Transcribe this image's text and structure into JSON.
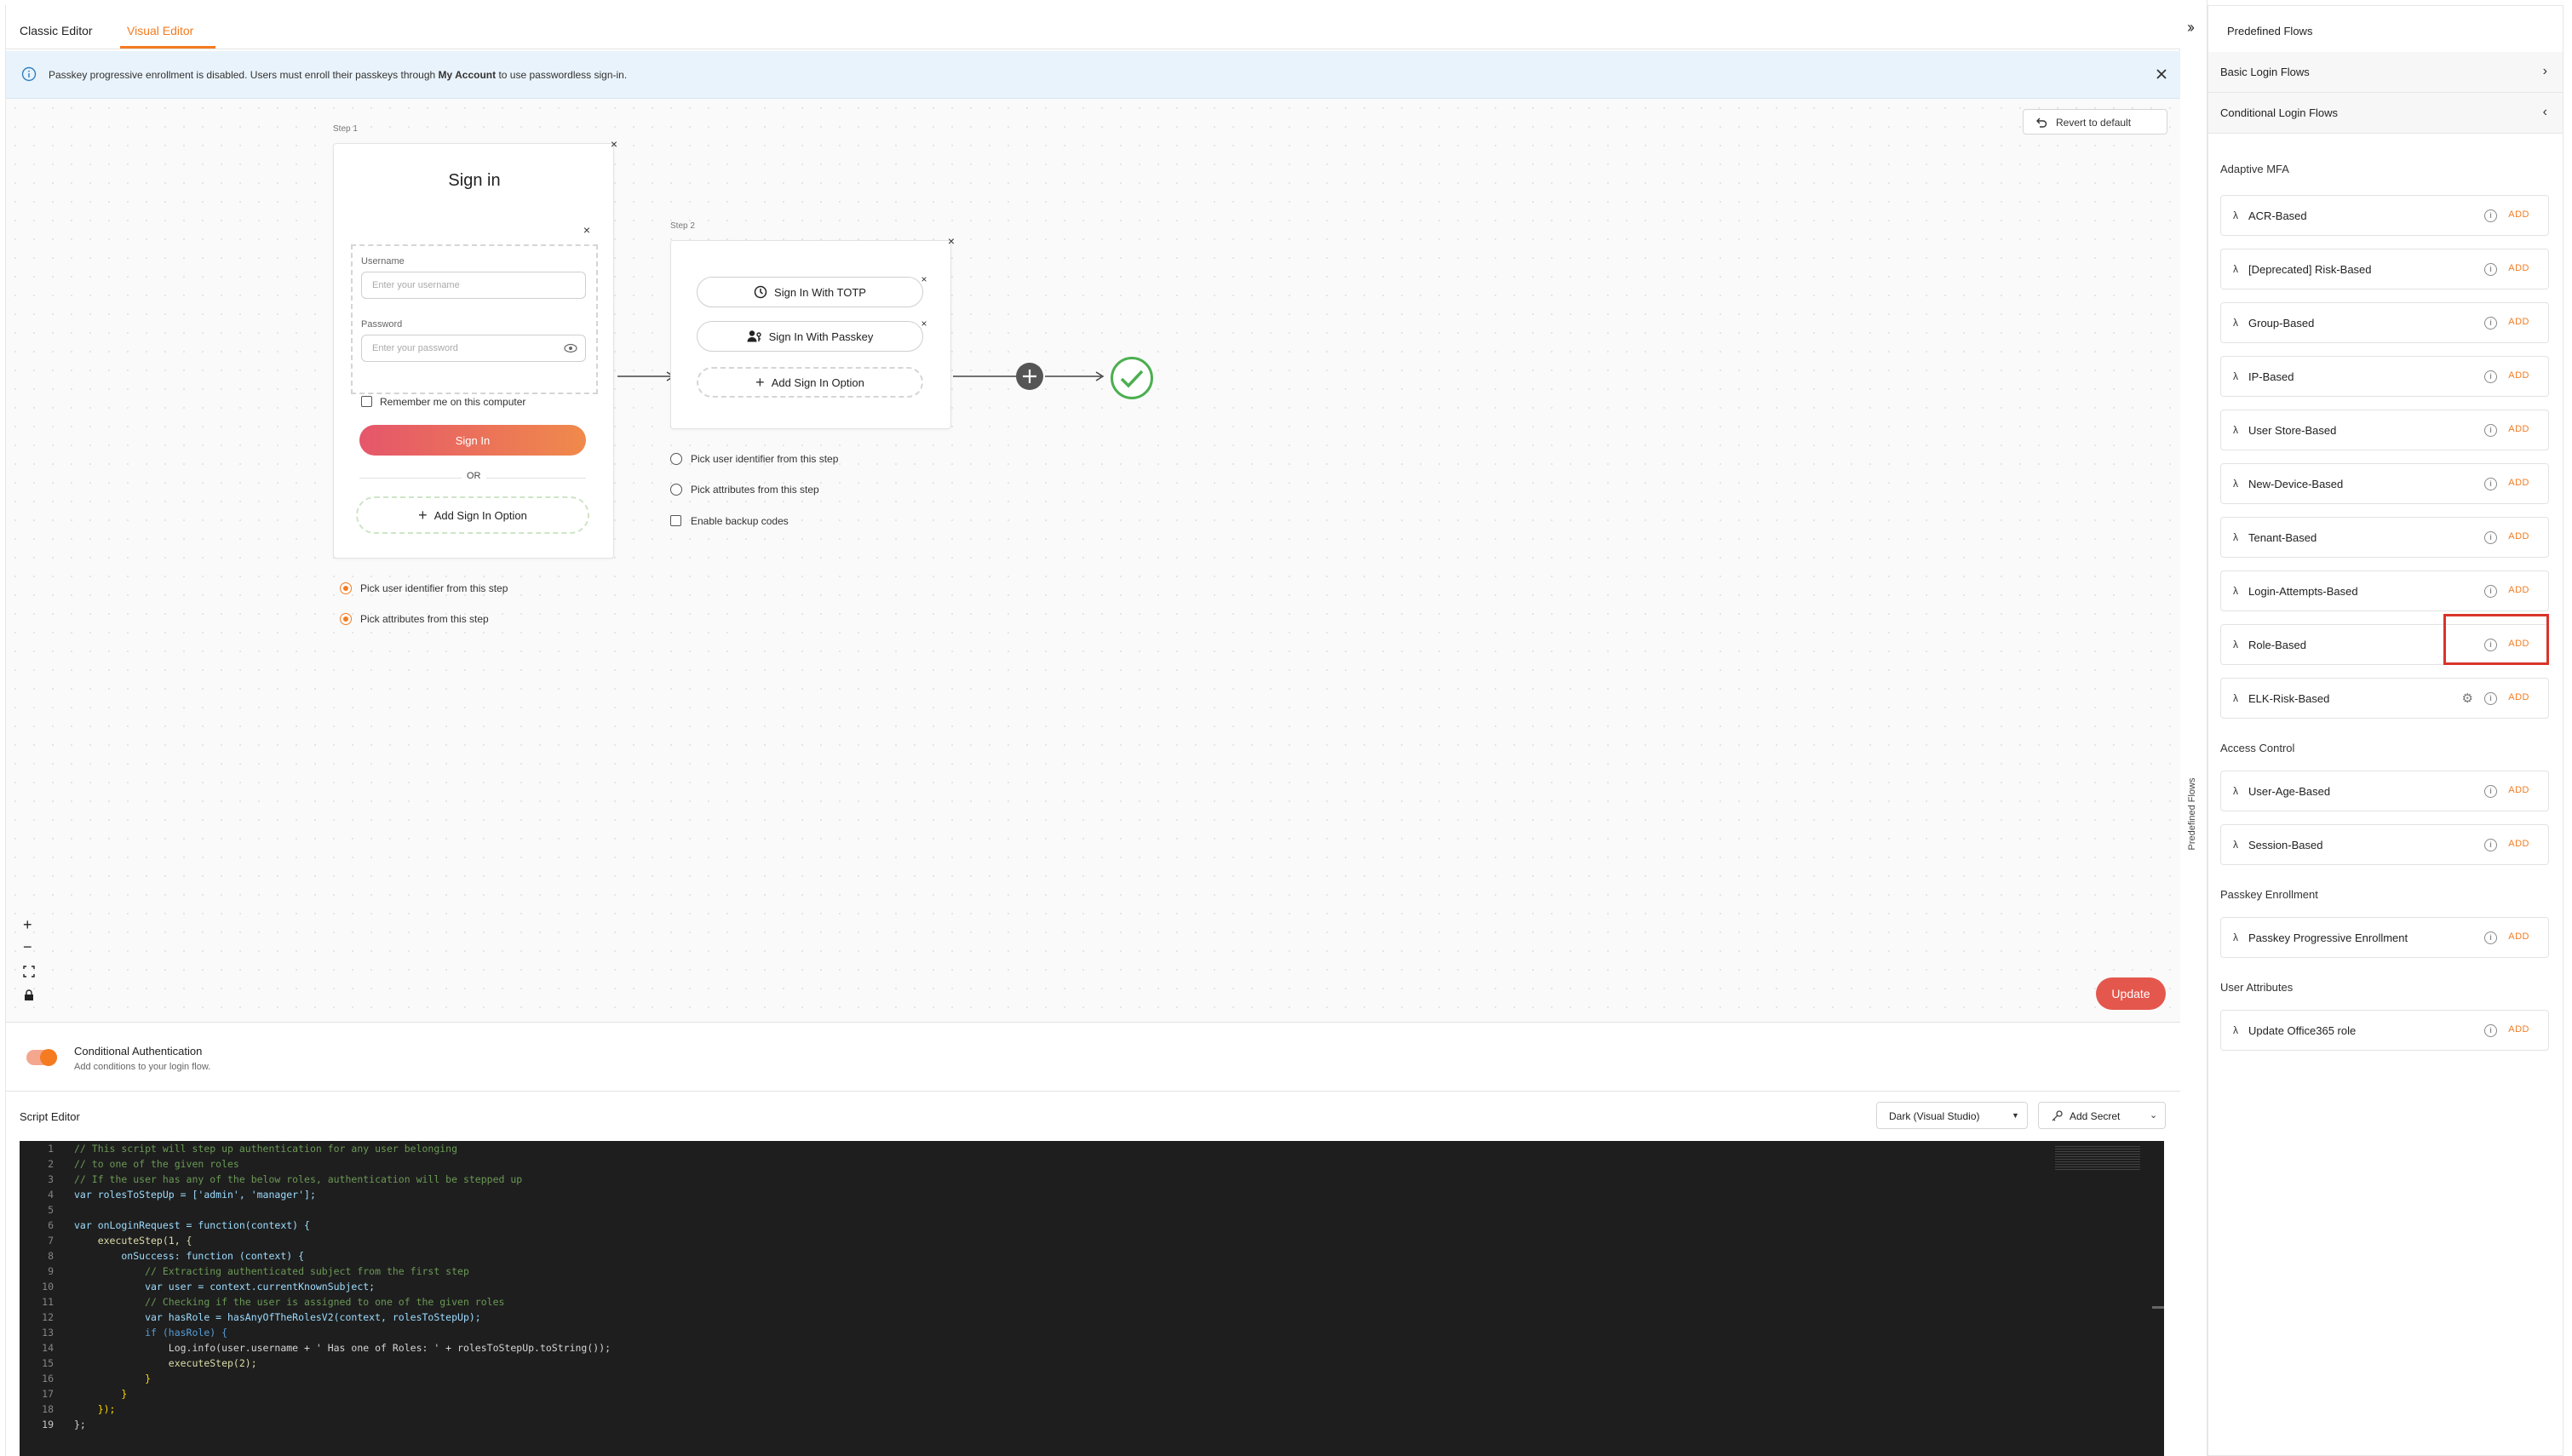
{
  "tabs": {
    "classic": "Classic Editor",
    "visual": "Visual Editor"
  },
  "banner": {
    "text_before": "Passkey progressive enrollment is disabled. Users must enroll their passkeys through ",
    "link": "My Account",
    "text_after": " to use passwordless sign-in."
  },
  "canvas": {
    "revert_label": "Revert to default",
    "update_label": "Update",
    "step1": {
      "label": "Step 1",
      "title": "Sign in",
      "username_label": "Username",
      "username_placeholder": "Enter your username",
      "password_label": "Password",
      "password_placeholder": "Enter your password",
      "remember_label": "Remember me on this computer",
      "signin_button": "Sign In",
      "or_text": "OR",
      "add_option": "Add Sign In Option",
      "opt_identifier": "Pick user identifier from this step",
      "opt_attributes": "Pick attributes from this step"
    },
    "step2": {
      "label": "Step 2",
      "totp": "Sign In With TOTP",
      "passkey": "Sign In With Passkey",
      "add_option": "Add Sign In Option",
      "opt_identifier": "Pick user identifier from this step",
      "opt_attributes": "Pick attributes from this step",
      "opt_backup": "Enable backup codes"
    }
  },
  "conditional": {
    "title": "Conditional Authentication",
    "subtitle": "Add conditions to your login flow.",
    "enabled": true
  },
  "script_editor": {
    "title": "Script Editor",
    "theme": "Dark (Visual Studio)",
    "add_secret": "Add Secret",
    "lines": [
      "// This script will step up authentication for any user belonging",
      "// to one of the given roles",
      "// If the user has any of the below roles, authentication will be stepped up",
      "var rolesToStepUp = ['admin', 'manager'];",
      "",
      "var onLoginRequest = function(context) {",
      "    executeStep(1, {",
      "        onSuccess: function (context) {",
      "            // Extracting authenticated subject from the first step",
      "            var user = context.currentKnownSubject;",
      "            // Checking if the user is assigned to one of the given roles",
      "            var hasRole = hasAnyOfTheRolesV2(context, rolesToStepUp);",
      "            if (hasRole) {",
      "                Log.info(user.username + ' Has one of Roles: ' + rolesToStepUp.toString());",
      "                executeStep(2);",
      "            }",
      "        }",
      "    });",
      "};"
    ]
  },
  "right_panel": {
    "title": "Predefined Flows",
    "vertical_label": "Predefined Flows",
    "basic": "Basic Login Flows",
    "conditional": "Conditional Login Flows",
    "add_label": "ADD",
    "sections": [
      {
        "title": "Adaptive MFA",
        "items": [
          "ACR-Based",
          "[Deprecated] Risk-Based",
          "Group-Based",
          "IP-Based",
          "User Store-Based",
          "New-Device-Based",
          "Tenant-Based",
          "Login-Attempts-Based",
          "Role-Based",
          "ELK-Risk-Based"
        ]
      },
      {
        "title": "Access Control",
        "items": [
          "User-Age-Based",
          "Session-Based"
        ]
      },
      {
        "title": "Passkey Enrollment",
        "items": [
          "Passkey Progressive Enrollment"
        ]
      },
      {
        "title": "User Attributes",
        "items": [
          "Update Office365 role"
        ]
      }
    ]
  },
  "colors": {
    "accent": "#f47b20",
    "highlight": "#d9342b"
  }
}
